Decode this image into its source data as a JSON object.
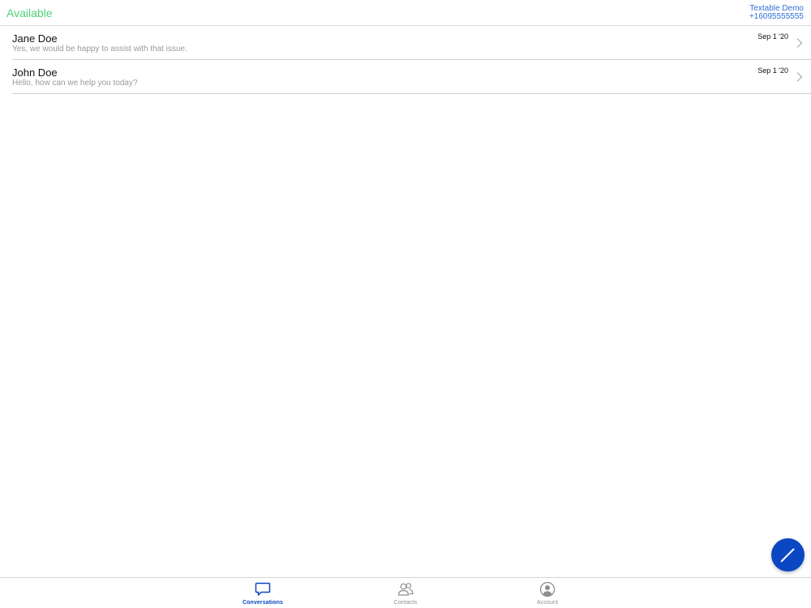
{
  "header": {
    "status": "Available",
    "account_name": "Textable Demo",
    "account_phone": "+16095555555"
  },
  "conversations": [
    {
      "name": "Jane Doe",
      "preview": "Yes, we would be happy to assist with that issue.",
      "date": "Sep 1 '20"
    },
    {
      "name": "John Doe",
      "preview": "Hello, how can we help you today?",
      "date": "Sep 1 '20"
    }
  ],
  "fab": {
    "icon": "pencil-icon"
  },
  "tabbar": {
    "tabs": [
      {
        "label": "Conversations",
        "icon": "chat-bubble-icon",
        "active": true
      },
      {
        "label": "Contacts",
        "icon": "people-icon",
        "active": false
      },
      {
        "label": "Account",
        "icon": "user-circle-icon",
        "active": false
      }
    ]
  },
  "colors": {
    "status_green": "#4cd175",
    "accent_blue": "#0b47c3",
    "link_blue": "#2f6fd6",
    "muted_text": "#9a9a9a"
  }
}
